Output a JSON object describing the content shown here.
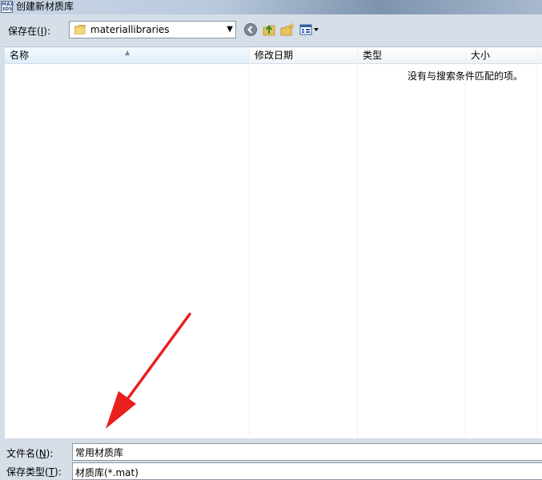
{
  "window": {
    "title": "创建新材质库",
    "app_icon_text_top": "MAX",
    "app_icon_text_bottom": "3DS"
  },
  "toolbar": {
    "save_in_label_prefix": "保存在(",
    "save_in_label_key": "I",
    "save_in_label_suffix": "):",
    "current_folder": "materiallibraries",
    "icons": [
      "back-icon",
      "up-folder-icon",
      "new-folder-icon",
      "view-menu-icon"
    ]
  },
  "file_list": {
    "columns": [
      {
        "label": "名称"
      },
      {
        "label": "修改日期"
      },
      {
        "label": "类型"
      },
      {
        "label": "大小"
      }
    ],
    "empty_message": "没有与搜索条件匹配的项。"
  },
  "file_name": {
    "label_prefix": "文件名(",
    "label_key": "N",
    "label_suffix": "):",
    "value": "常用材质库"
  },
  "file_type": {
    "label_prefix": "保存类型(",
    "label_key": "T",
    "label_suffix": "):",
    "value": "材质库(*.mat)"
  },
  "colors": {
    "annotation_arrow": "#e8201e",
    "window_bg": "#d6dee8",
    "header_sorted": "#ddeefb"
  }
}
